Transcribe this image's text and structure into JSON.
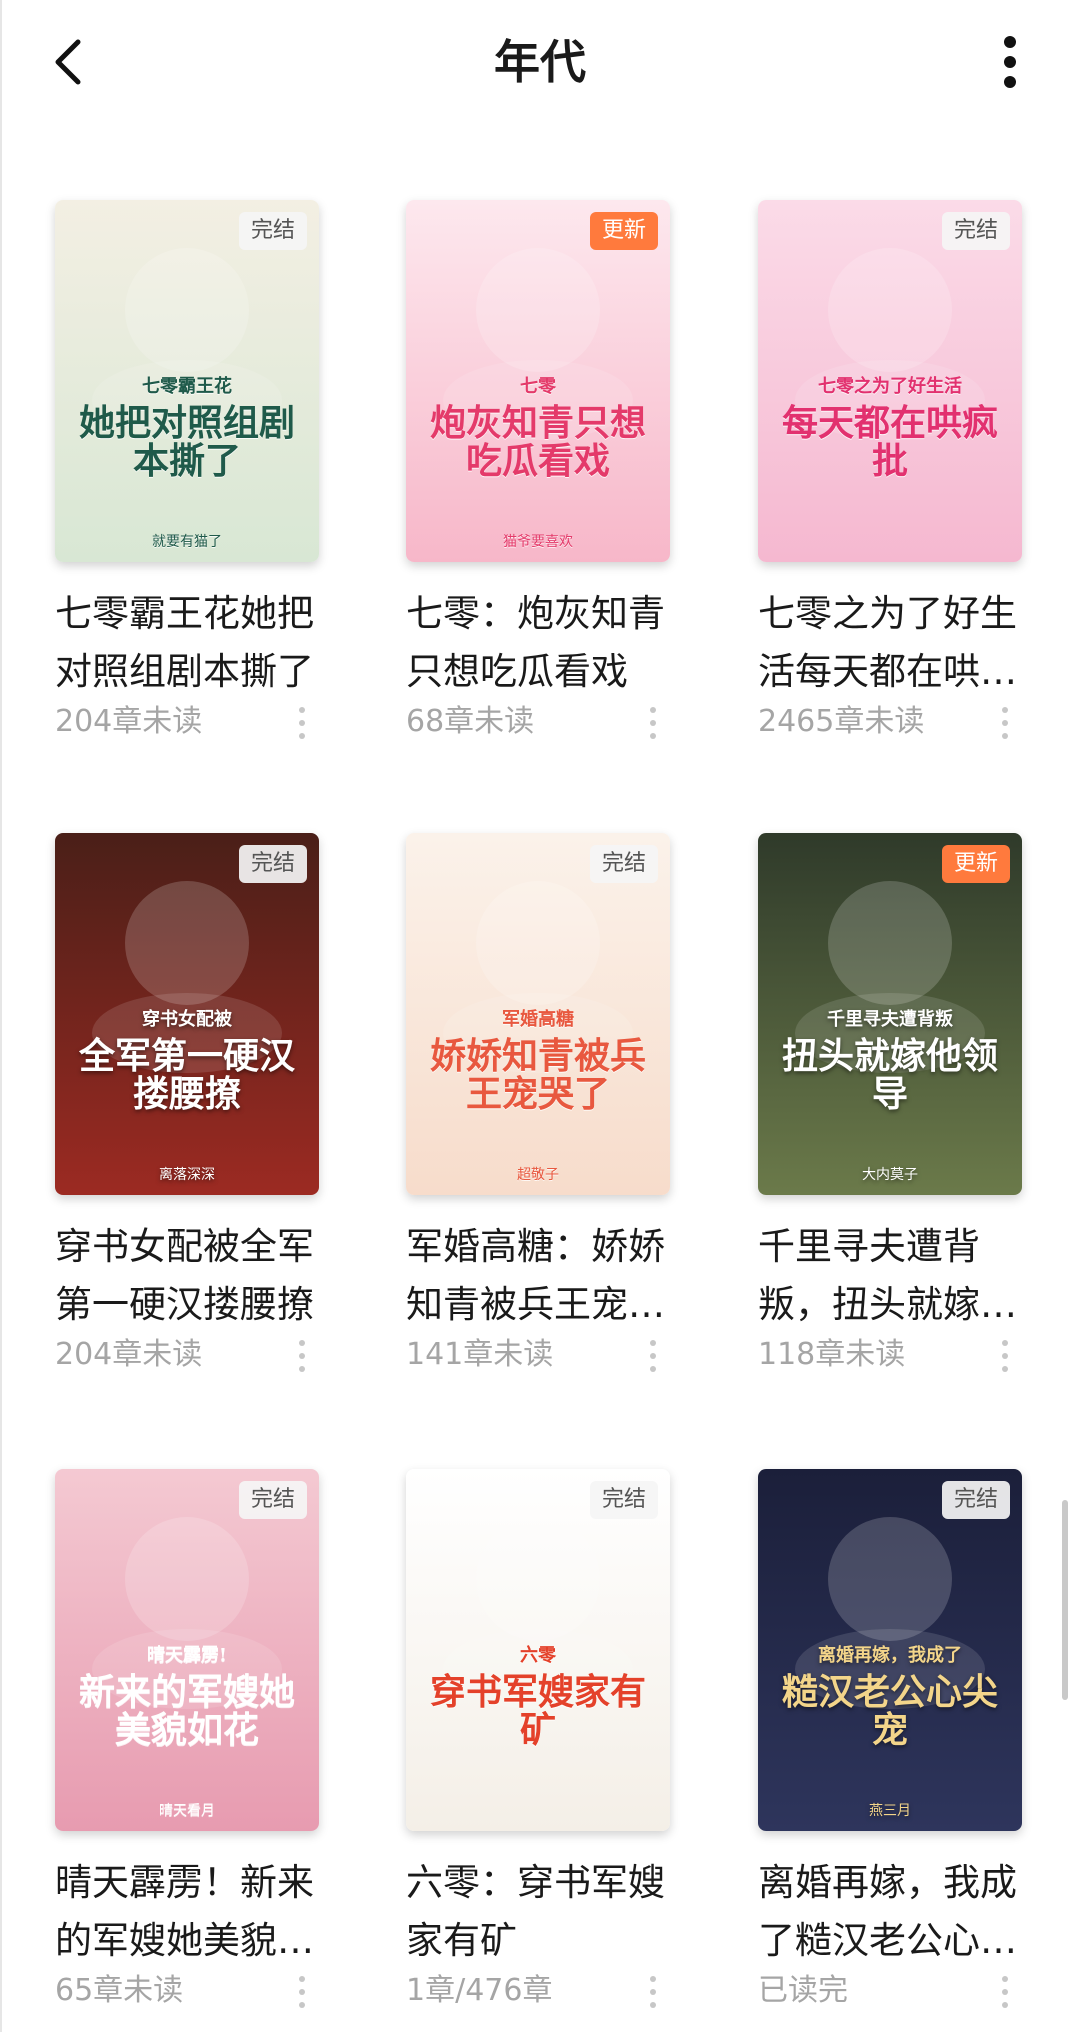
{
  "header": {
    "title": "年代",
    "back_icon": "chevron-left-icon",
    "more_icon": "more-vertical-icon"
  },
  "books": [
    {
      "title": "七零霸王花她把对照组剧本撕了",
      "status": "204章未读",
      "badge": "完结",
      "cover_text": "她把对照组剧本撕了",
      "cover_top_text": "七零霸王花",
      "cover_author": "就要有猫了",
      "cover_colors": [
        "#f3efe3",
        "#d8e7d4"
      ],
      "title_color": "#1f5a4a"
    },
    {
      "title": "七零：炮灰知青只想吃瓜看戏",
      "status": "68章未读",
      "badge": "更新",
      "cover_text": "炮灰知青只想吃瓜看戏",
      "cover_top_text": "七零",
      "cover_author": "猫爷要喜欢",
      "cover_colors": [
        "#fde8ee",
        "#f7b7c9"
      ],
      "title_color": "#e43a6a"
    },
    {
      "title": "七零之为了好生活每天都在哄疯批",
      "status": "2465章未读",
      "badge": "完结",
      "cover_text": "每天都在哄疯批",
      "cover_top_text": "七零之为了好生活",
      "cover_author": "",
      "cover_colors": [
        "#fbdbe8",
        "#f5b8d0"
      ],
      "title_color": "#e2316f"
    },
    {
      "title": "穿书女配被全军第一硬汉搂腰撩",
      "status": "204章未读",
      "badge": "完结",
      "cover_text": "全军第一硬汉搂腰撩",
      "cover_top_text": "穿书女配被",
      "cover_author": "离落深深",
      "cover_colors": [
        "#4a1f18",
        "#9c2a22"
      ],
      "title_color": "#ffffff"
    },
    {
      "title": "军婚高糖：娇娇知青被兵王宠哭了",
      "status": "141章未读",
      "badge": "完结",
      "cover_text": "娇娇知青被兵王宠哭了",
      "cover_top_text": "军婚高糖",
      "cover_author": "超敬子",
      "cover_colors": [
        "#fbf2ea",
        "#f7dccb"
      ],
      "title_color": "#e8583f"
    },
    {
      "title": "千里寻夫遭背叛，扭头就嫁他领导",
      "status": "118章未读",
      "badge": "更新",
      "cover_text": "扭头就嫁他领导",
      "cover_top_text": "千里寻夫遭背叛",
      "cover_author": "大内莫子",
      "cover_colors": [
        "#2f3a2a",
        "#6b7a4a"
      ],
      "title_color": "#ffffff"
    },
    {
      "title": "晴天霹雳！新来的军嫂她美貌如花",
      "status": "65章未读",
      "badge": "完结",
      "cover_text": "新来的军嫂她美貌如花",
      "cover_top_text": "晴天霹雳!",
      "cover_author": "晴天看月",
      "cover_colors": [
        "#f4c9d2",
        "#e79bb0"
      ],
      "title_color": "#ffffff"
    },
    {
      "title": "六零：穿书军嫂家有矿",
      "status": "1章/476章",
      "badge": "完结",
      "cover_text": "穿书军嫂家有矿",
      "cover_top_text": "六零",
      "cover_author": "",
      "cover_colors": [
        "#ffffff",
        "#f4efe7"
      ],
      "title_color": "#e4412a"
    },
    {
      "title": "离婚再嫁，我成了糙汉老公心尖宠",
      "status": "已读完",
      "badge": "完结",
      "cover_text": "糙汉老公心尖宠",
      "cover_top_text": "离婚再嫁，我成了",
      "cover_author": "燕三月",
      "cover_colors": [
        "#1b1f3a",
        "#2e355c"
      ],
      "title_color": "#f3d58a"
    }
  ]
}
